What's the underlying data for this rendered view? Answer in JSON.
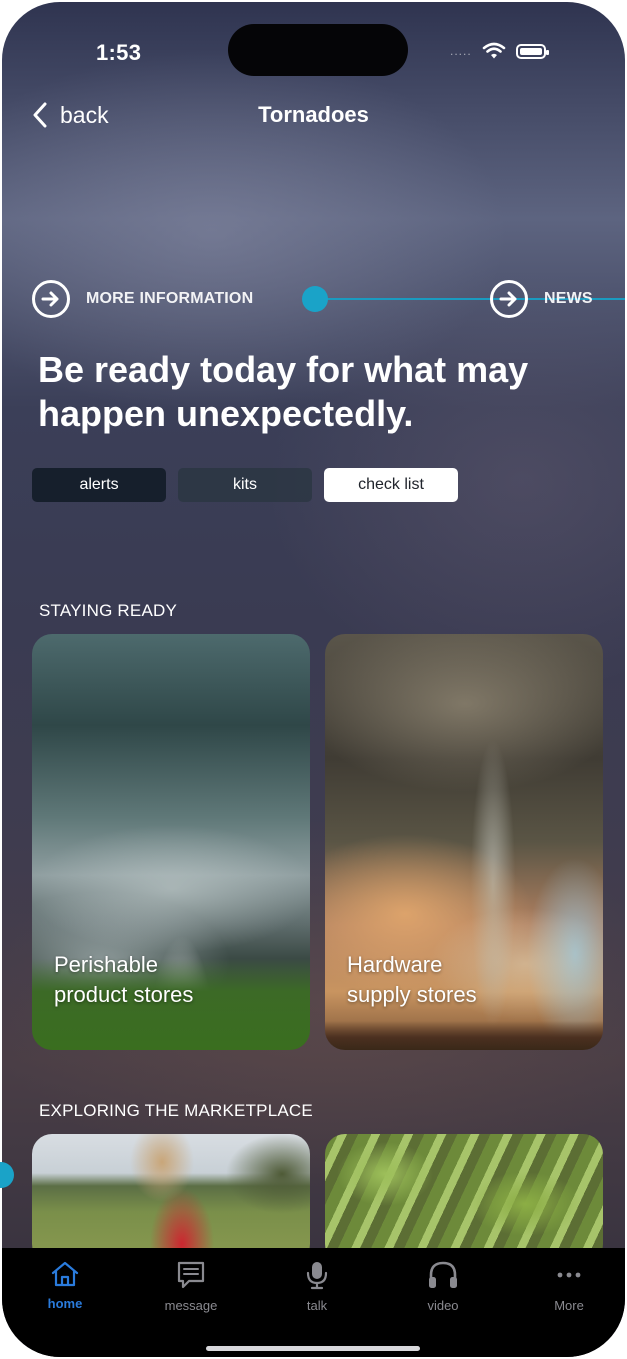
{
  "status_bar": {
    "time": "1:53",
    "signal_dots": "....."
  },
  "nav": {
    "back_label": "back",
    "title": "Tornadoes"
  },
  "links": {
    "more_info": "MORE INFORMATION",
    "news": "NEWS"
  },
  "headline": "Be ready today for what may happen unexpectedly.",
  "chips": [
    {
      "label": "alerts",
      "selected": false
    },
    {
      "label": "kits",
      "selected": false
    },
    {
      "label": "check list",
      "selected": true
    }
  ],
  "sections": {
    "staying_ready": {
      "title": "STAYING READY",
      "cards": [
        {
          "line1": "Perishable",
          "line2": "product stores"
        },
        {
          "line1": "Hardware",
          "line2": "supply stores"
        }
      ]
    },
    "marketplace": {
      "title": "EXPLORING THE MARKETPLACE"
    }
  },
  "tabs": [
    {
      "label": "home",
      "icon": "home-icon",
      "active": true
    },
    {
      "label": "message",
      "icon": "message-icon",
      "active": false
    },
    {
      "label": "talk",
      "icon": "microphone-icon",
      "active": false
    },
    {
      "label": "video",
      "icon": "headphones-icon",
      "active": false
    },
    {
      "label": "More",
      "icon": "more-dots-icon",
      "active": false
    }
  ],
  "colors": {
    "accent": "#1aa3c8",
    "tab_active": "#2a7bdc",
    "tab_inactive": "#8a8a90"
  }
}
